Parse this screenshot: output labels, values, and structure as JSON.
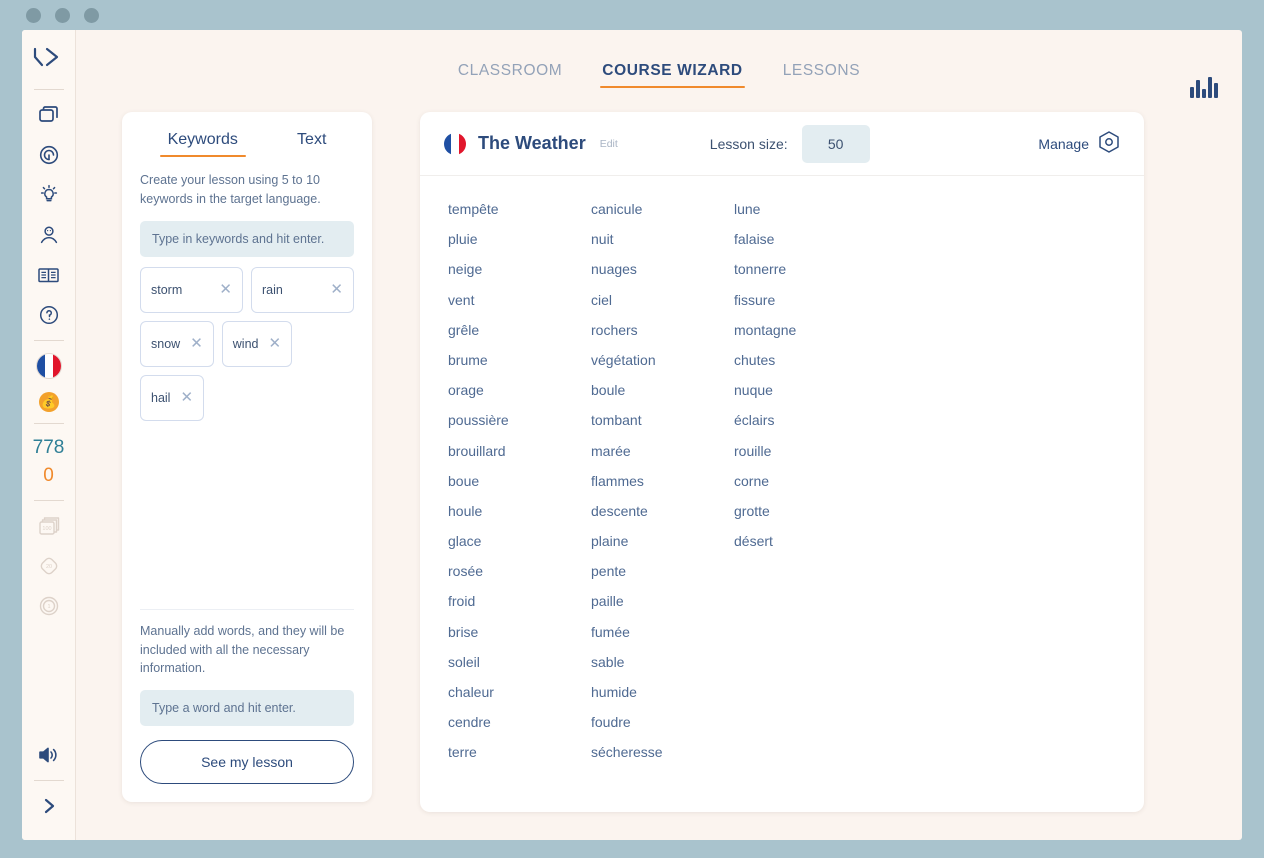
{
  "window": {
    "dots": 3
  },
  "sidebar": {
    "logo": "logo-chevrons",
    "items": [
      {
        "name": "cards-icon",
        "label": "Cards"
      },
      {
        "name": "target-icon",
        "label": "Practice"
      },
      {
        "name": "lightbulb-icon",
        "label": "Ideas"
      },
      {
        "name": "avatar-icon",
        "label": "Profile"
      },
      {
        "name": "book-icon",
        "label": "Library"
      },
      {
        "name": "help-icon",
        "label": "Help"
      }
    ],
    "language_flag": "french-flag",
    "coin_icon": "coin-icon",
    "counter_primary": "778",
    "counter_secondary": "0",
    "badges": [
      {
        "name": "badge-100-icon",
        "label": "100"
      },
      {
        "name": "badge-20-icon",
        "label": "20"
      },
      {
        "name": "badge-1-icon",
        "label": "1"
      }
    ],
    "sound_icon": "speaker-icon",
    "expand_icon": "chevron-right-icon"
  },
  "topnav": {
    "tabs": [
      {
        "label": "CLASSROOM",
        "active": false
      },
      {
        "label": "COURSE WIZARD",
        "active": true
      },
      {
        "label": "LESSONS",
        "active": false
      }
    ],
    "chart_icon": "bar-chart-icon",
    "accent_color": "#f08a2c"
  },
  "left_panel": {
    "tabs": [
      {
        "label": "Keywords",
        "active": true
      },
      {
        "label": "Text",
        "active": false
      }
    ],
    "helper_text": "Create your lesson using 5 to 10 keywords in the target language.",
    "keyword_input_placeholder": "Type in keywords and hit enter.",
    "keywords": [
      {
        "label": "storm",
        "remove": "✕"
      },
      {
        "label": "rain",
        "remove": "✕"
      },
      {
        "label": "snow",
        "remove": "✕"
      },
      {
        "label": "wind",
        "remove": "✕"
      },
      {
        "label": "hail",
        "remove": "✕"
      }
    ],
    "manual_text": "Manually add words, and they will be included with all the necessary information.",
    "word_input_placeholder": "Type a word and hit enter.",
    "see_lesson_button": "See my lesson"
  },
  "right_panel": {
    "flag": "french-flag",
    "title": "The Weather",
    "edit_label": "Edit",
    "lesson_size_label": "Lesson size:",
    "lesson_size_value": "50",
    "manage_label": "Manage",
    "manage_icon": "hexagon-gear-icon",
    "columns": [
      [
        "tempête",
        "pluie",
        "neige",
        "vent",
        "grêle",
        "brume",
        "orage",
        "poussière",
        "brouillard",
        "boue",
        "houle",
        "glace",
        "rosée",
        "froid",
        "brise",
        "soleil",
        "chaleur",
        "cendre",
        "terre"
      ],
      [
        "canicule",
        "nuit",
        "nuages",
        "ciel",
        "rochers",
        "végétation",
        "boule",
        "tombant",
        "marée",
        "flammes",
        "descente",
        "plaine",
        "pente",
        "paille",
        "fumée",
        "sable",
        "humide",
        "foudre",
        "sécheresse"
      ],
      [
        "lune",
        "falaise",
        "tonnerre",
        "fissure",
        "montagne",
        "chutes",
        "nuque",
        "éclairs",
        "rouille",
        "corne",
        "grotte",
        "désert"
      ]
    ]
  },
  "colors": {
    "accent_orange": "#f08a2c",
    "navy": "#2d4b7c",
    "word_blue": "#4f6a92",
    "input_bg": "#e3edf1",
    "page_bg": "#fbf4ef",
    "frame_bg": "#a9c3cd",
    "teal_counter": "#2f7f96"
  }
}
